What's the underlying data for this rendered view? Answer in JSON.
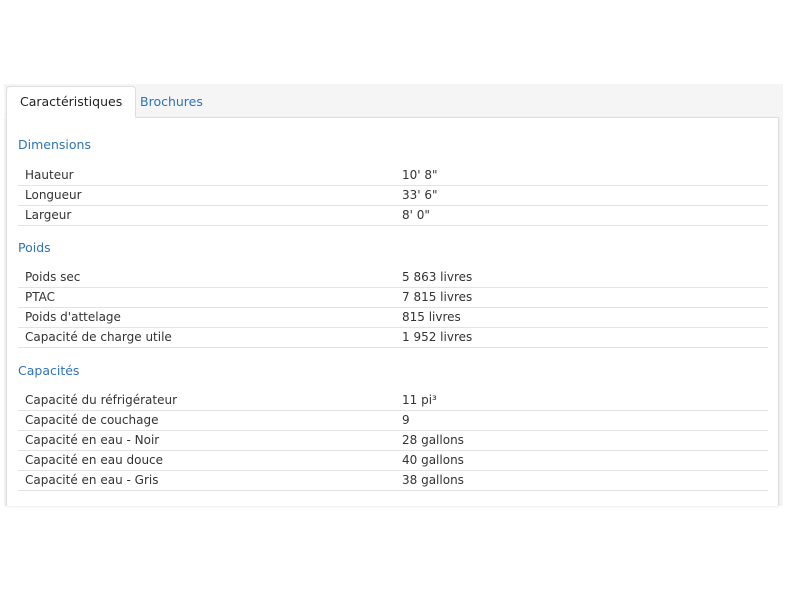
{
  "tabs": [
    {
      "label": "Caractéristiques",
      "active": true
    },
    {
      "label": "Brochures",
      "active": false
    }
  ],
  "sections": [
    {
      "title": "Dimensions",
      "rows": [
        {
          "label": "Hauteur",
          "value": "10' 8\""
        },
        {
          "label": "Longueur",
          "value": "33' 6\""
        },
        {
          "label": "Largeur",
          "value": "8' 0\""
        }
      ]
    },
    {
      "title": "Poids",
      "rows": [
        {
          "label": "Poids sec",
          "value": "5 863 livres"
        },
        {
          "label": "PTAC",
          "value": "7 815 livres"
        },
        {
          "label": "Poids d'attelage",
          "value": "815 livres"
        },
        {
          "label": "Capacité de charge utile",
          "value": "1 952 livres"
        }
      ]
    },
    {
      "title": "Capacités",
      "rows": [
        {
          "label": "Capacité du réfrigérateur",
          "value": "11 pi³"
        },
        {
          "label": "Capacité de couchage",
          "value": "9"
        },
        {
          "label": "Capacité en eau - Noir",
          "value": "28 gallons"
        },
        {
          "label": "Capacité en eau douce",
          "value": "40 gallons"
        },
        {
          "label": "Capacité en eau - Gris",
          "value": "38 gallons"
        }
      ]
    }
  ],
  "colors": {
    "link": "#2e73b8",
    "text": "#333333",
    "divider": "#e3e3e3"
  }
}
